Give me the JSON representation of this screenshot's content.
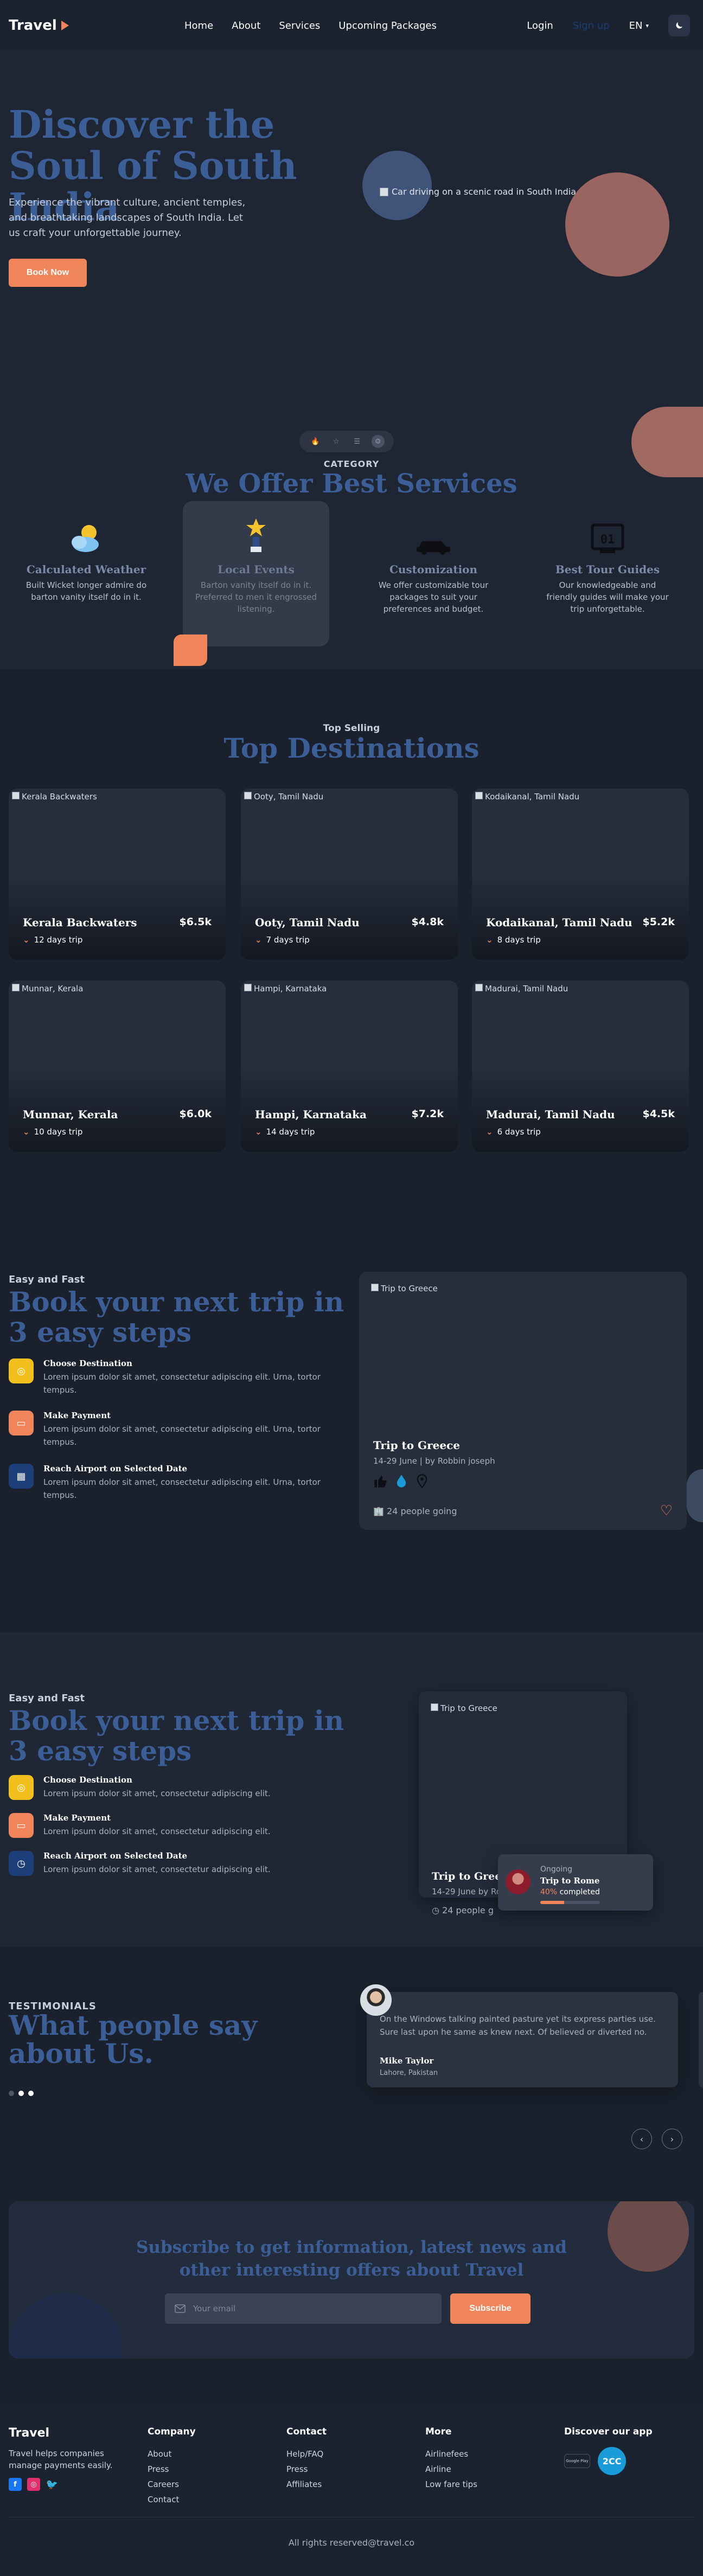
{
  "nav": {
    "brand": "Travel",
    "links": [
      "Home",
      "About",
      "Services",
      "Upcoming Packages"
    ],
    "login": "Login",
    "signup": "Sign up",
    "lang": "EN"
  },
  "hero": {
    "title": "Discover the Soul of South India",
    "subtitle": "Experience the vibrant culture, ancient temples, and breathtaking landscapes of South India. Let us craft your unforgettable journey.",
    "cta": "Book Now",
    "image_alt": "Car driving on a scenic road in South India"
  },
  "services": {
    "label": "CATEGORY",
    "title": "We Offer Best Services",
    "items": [
      {
        "title": "Calculated Weather",
        "text": "Built Wicket longer admire do barton vanity itself do in it.",
        "icon": "weather-icon"
      },
      {
        "title": "Local Events",
        "text": "Barton vanity itself do in it. Preferred to men it engrossed listening.",
        "icon": "trophy-icon"
      },
      {
        "title": "Customization",
        "text": "We offer customizable tour packages to suit your preferences and budget.",
        "icon": "car-icon"
      },
      {
        "title": "Best Tour Guides",
        "text": "Our knowledgeable and friendly guides will make your trip unforgettable.",
        "icon": "calendar-icon"
      }
    ]
  },
  "destinations": {
    "label": "Top Selling",
    "title": "Top Destinations",
    "items": [
      {
        "alt": "Kerala Backwaters",
        "name": "Kerala Backwaters",
        "price": "$6.5k",
        "duration": "12 days trip"
      },
      {
        "alt": "Ooty, Tamil Nadu",
        "name": "Ooty, Tamil Nadu",
        "price": "$4.8k",
        "duration": "7 days trip"
      },
      {
        "alt": "Kodaikanal, Tamil Nadu",
        "name": "Kodaikanal, Tamil Nadu",
        "price": "$5.2k",
        "duration": "8 days trip"
      },
      {
        "alt": "Munnar, Kerala",
        "name": "Munnar, Kerala",
        "price": "$6.0k",
        "duration": "10 days trip"
      },
      {
        "alt": "Hampi, Karnataka",
        "name": "Hampi, Karnataka",
        "price": "$7.2k",
        "duration": "14 days trip"
      },
      {
        "alt": "Madurai, Tamil Nadu",
        "name": "Madurai, Tamil Nadu",
        "price": "$4.5k",
        "duration": "6 days trip"
      }
    ]
  },
  "steps1": {
    "label": "Easy and Fast",
    "title": "Book your next trip in 3 easy steps",
    "items": [
      {
        "title": "Choose Destination",
        "text": "Lorem ipsum dolor sit amet, consectetur adipiscing elit. Urna, tortor tempus.",
        "color": "#f2bf1d"
      },
      {
        "title": "Make Payment",
        "text": "Lorem ipsum dolor sit amet, consectetur adipiscing elit. Urna, tortor tempus.",
        "color": "#f0855a"
      },
      {
        "title": "Reach Airport on Selected Date",
        "text": "Lorem ipsum dolor sit amet, consectetur adipiscing elit. Urna, tortor tempus.",
        "color": "#1c3f7a"
      }
    ],
    "card": {
      "alt": "Trip to Greece",
      "title": "Trip to Greece",
      "date": "14-29 June | by Robbin joseph",
      "people": "24 people going"
    }
  },
  "steps2": {
    "label": "Easy and Fast",
    "title": "Book your next trip in 3 easy steps",
    "items": [
      {
        "title": "Choose Destination",
        "text": "Lorem ipsum dolor sit amet, consectetur adipiscing elit.",
        "color": "#f2bf1d"
      },
      {
        "title": "Make Payment",
        "text": "Lorem ipsum dolor sit amet, consectetur adipiscing elit.",
        "color": "#f0855a"
      },
      {
        "title": "Reach Airport on Selected Date",
        "text": "Lorem ipsum dolor sit amet, consectetur adipiscing elit.",
        "color": "#1c3f7a"
      }
    ],
    "card": {
      "alt": "Trip to Greece",
      "title": "Trip to Greece",
      "date": "14-29 June by Robbin Joseph",
      "people": "24 people g"
    },
    "ongoing": {
      "label": "Ongoing",
      "title": "Trip to Rome",
      "percent": "40%",
      "completed": "completed",
      "progress": 0.4
    }
  },
  "testimonials": {
    "label": "TESTIMONIALS",
    "title": "What people say about Us.",
    "quote": "On the Windows talking painted pasture yet its express parties use. Sure last upon he same as knew next. Of believed or diverted no.",
    "name": "Mike Taylor",
    "location": "Lahore, Pakistan"
  },
  "subscribe": {
    "title": "Subscribe to get information, latest news and other interesting offers about Travel",
    "placeholder": "Your email",
    "button": "Subscribe"
  },
  "footer": {
    "brand": "Travel",
    "tagline": "Travel helps companies manage payments easily.",
    "company": {
      "title": "Company",
      "links": [
        "About",
        "Press",
        "Careers",
        "Contact"
      ]
    },
    "contact": {
      "title": "Contact",
      "links": [
        "Help/FAQ",
        "Press",
        "Affiliates"
      ]
    },
    "more": {
      "title": "More",
      "links": [
        "Airlinefees",
        "Airline",
        "Low fare tips"
      ]
    },
    "apps": {
      "title": "Discover our app",
      "badge1": "Google Play",
      "badge2": "2CC"
    },
    "copyright": "All rights reserved@travel.co"
  }
}
